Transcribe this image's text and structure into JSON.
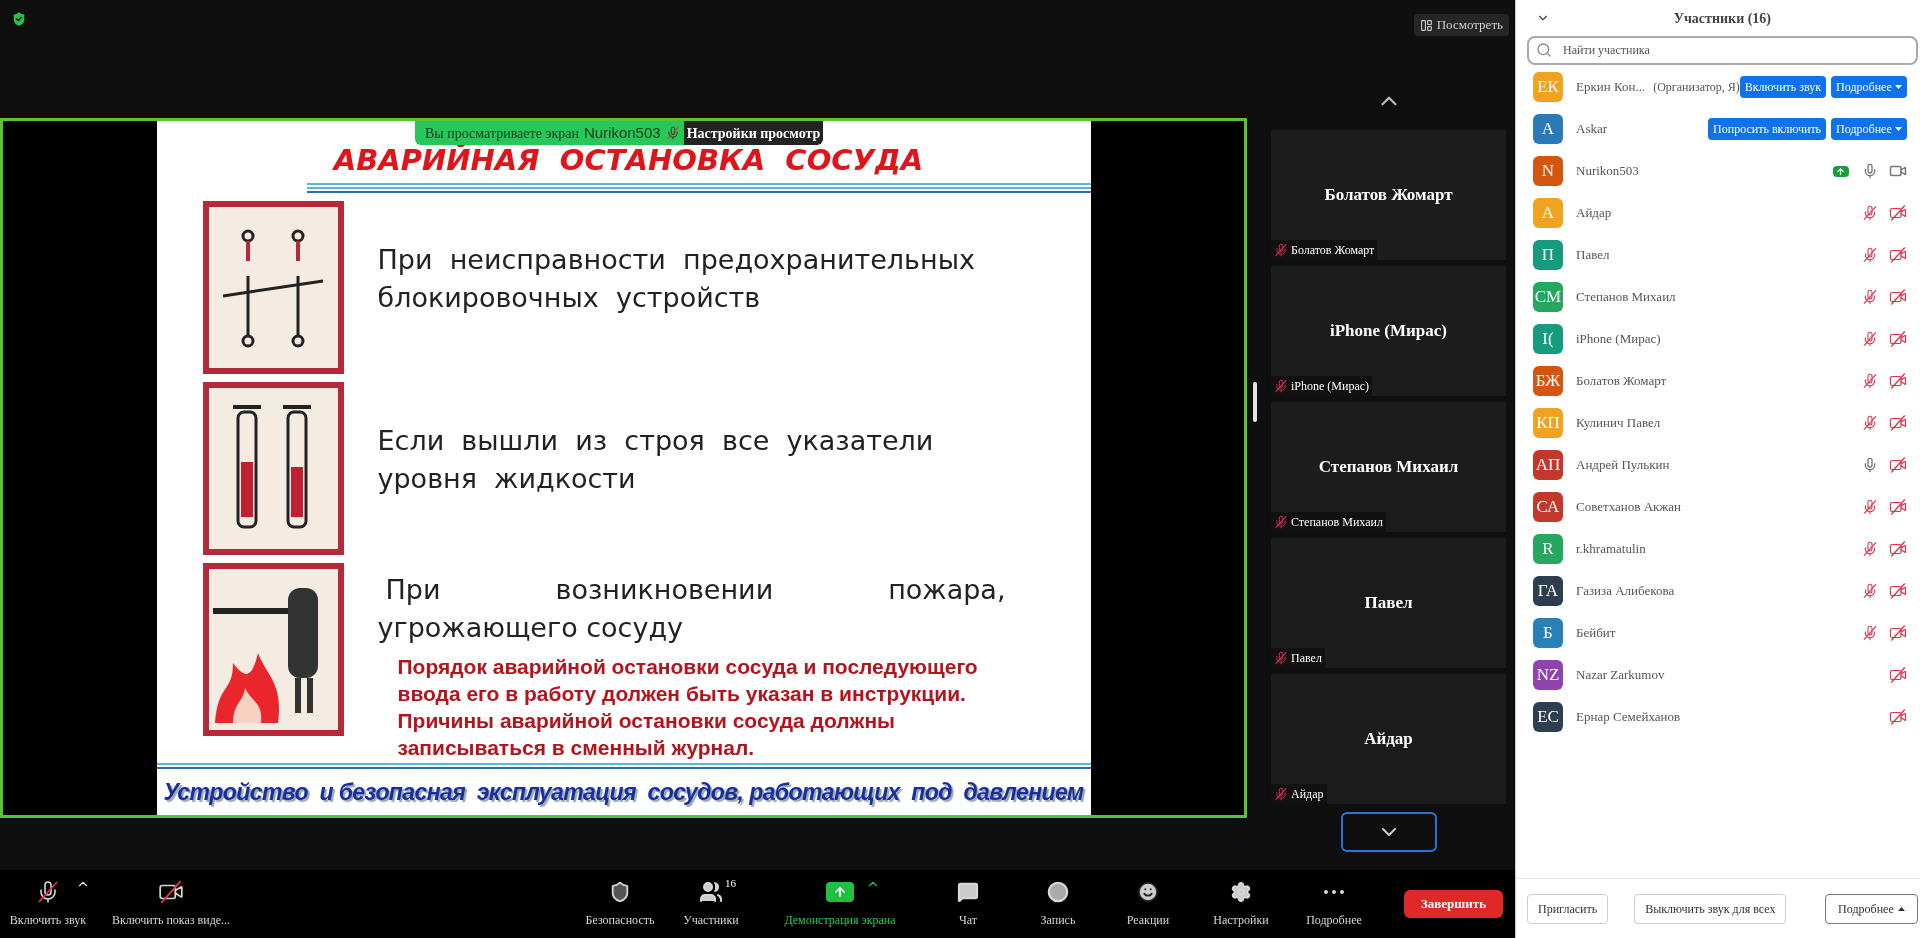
{
  "top_bar": {
    "view_button": "Посмотреть"
  },
  "share_banner": {
    "text": "Вы просматриваете экран",
    "presenter": "Nurikon503",
    "settings": "Настройки просмотр"
  },
  "slide": {
    "title": "АВАРИЙНАЯ  ОСТАНОВКА  СОСУДА",
    "items": [
      {
        "kind": "switch",
        "lines": [
          "При  неисправности  предохранительных",
          "блокировочных  устройств"
        ],
        "spread_first": false
      },
      {
        "kind": "gauge",
        "lines": [
          "Если  вышли  из  строя  все  указатели",
          "уровня  жидкости"
        ],
        "spread_first": false
      },
      {
        "kind": "fire",
        "lines": [
          "При возникновении пожара,",
          "угрожающего сосуду"
        ],
        "spread_first": true
      }
    ],
    "note": [
      "Порядок аварийной остановки сосуда и последующего",
      "ввода его в работу должен быть указан в инструкции.",
      "Причины аварийной остановки сосуда должны",
      "записываться в сменный журнал."
    ],
    "footer": "Устройство  и безопасная  эксплуатация  сосудов, работающих  под  давлением"
  },
  "video_tiles": [
    {
      "name": "Болатов Жомарт",
      "label": "Болатов Жомарт",
      "muted": true
    },
    {
      "name": "iPhone (Мирас)",
      "label": "iPhone (Мирас)",
      "muted": true
    },
    {
      "name": "Степанов Михаил",
      "label": "Степанов Михаил",
      "muted": true
    },
    {
      "name": "Павел",
      "label": "Павел",
      "muted": true
    },
    {
      "name": "Айдар",
      "label": "Айдар",
      "muted": true
    }
  ],
  "toolbar": {
    "items": [
      {
        "kind": "mic",
        "label": "Включить звук",
        "caret": true,
        "off": true
      },
      {
        "kind": "video",
        "label": "Включить показ виде...",
        "caret": false,
        "off": true
      },
      {
        "kind": "security",
        "label": "Безопасность",
        "caret": false
      },
      {
        "kind": "participants",
        "label": "Участники",
        "badge": "16",
        "caret": false
      },
      {
        "kind": "share",
        "label": "Демонстрация экрана",
        "caret": true
      },
      {
        "kind": "chat",
        "label": "Чат",
        "caret": false
      },
      {
        "kind": "record",
        "label": "Запись",
        "caret": false
      },
      {
        "kind": "reactions",
        "label": "Реакции",
        "caret": false
      },
      {
        "kind": "settings",
        "label": "Настройки",
        "caret": false
      },
      {
        "kind": "more",
        "label": "Подробнее",
        "caret": false
      }
    ],
    "end_button": "Завершить"
  },
  "participants": {
    "title": "Участники (16)",
    "search_placeholder": "Найти участника",
    "rows": [
      {
        "kind": "actions",
        "initials": "ЕК",
        "name": "Еркин Кон...",
        "role": "(Организатор, Я)",
        "color": "#f0a31f",
        "buttons": [
          "Включить звук",
          "Подробнее"
        ]
      },
      {
        "kind": "actions",
        "initials": "A",
        "name": "Askar",
        "color": "#2a79b8",
        "buttons": [
          "Попросить включить",
          "Подробнее"
        ]
      },
      {
        "kind": "status",
        "initials": "N",
        "name": "Nurikon503",
        "color": "#d3550f",
        "has_audio": true,
        "muted": false,
        "video_off": false,
        "sharing": true
      },
      {
        "kind": "status",
        "initials": "А",
        "name": "Айдар",
        "color": "#f0a31f",
        "has_audio": true,
        "muted": true,
        "video_off": true,
        "sharing": false
      },
      {
        "kind": "status",
        "initials": "П",
        "name": "Павел",
        "color": "#179b7f",
        "has_audio": true,
        "muted": true,
        "video_off": true,
        "sharing": false
      },
      {
        "kind": "status",
        "initials": "СМ",
        "name": "Степанов Михаил",
        "color": "#27a660",
        "has_audio": true,
        "muted": true,
        "video_off": true,
        "sharing": false
      },
      {
        "kind": "status",
        "initials": "I(",
        "name": "iPhone (Мирас)",
        "color": "#179b7f",
        "has_audio": true,
        "muted": true,
        "video_off": true,
        "sharing": false
      },
      {
        "kind": "status",
        "initials": "БЖ",
        "name": "Болатов Жомарт",
        "color": "#d3550f",
        "has_audio": true,
        "muted": true,
        "video_off": true,
        "sharing": false
      },
      {
        "kind": "status",
        "initials": "КП",
        "name": "Кулинич Павел",
        "color": "#f0a31f",
        "has_audio": true,
        "muted": true,
        "video_off": true,
        "sharing": false
      },
      {
        "kind": "status",
        "initials": "АП",
        "name": "Андрей Пулькин",
        "color": "#c0392b",
        "has_audio": true,
        "muted": false,
        "video_off": true,
        "sharing": false
      },
      {
        "kind": "status",
        "initials": "СА",
        "name": "Советханов Акжан",
        "color": "#c0392b",
        "has_audio": true,
        "muted": true,
        "video_off": true,
        "sharing": false
      },
      {
        "kind": "status",
        "initials": "R",
        "name": "r.khramatulin",
        "color": "#27a660",
        "has_audio": true,
        "muted": true,
        "video_off": true,
        "sharing": false
      },
      {
        "kind": "status",
        "initials": "ГА",
        "name": "Газиза Алибекова",
        "color": "#2c3e50",
        "has_audio": true,
        "muted": true,
        "video_off": true,
        "sharing": false
      },
      {
        "kind": "status",
        "initials": "Б",
        "name": "Бейбит",
        "color": "#2980b9",
        "has_audio": true,
        "muted": true,
        "video_off": true,
        "sharing": false
      },
      {
        "kind": "status",
        "initials": "NZ",
        "name": "Nazar Zarkumov",
        "color": "#8e44ad",
        "has_audio": false,
        "video_off": true,
        "sharing": false
      },
      {
        "kind": "status",
        "initials": "ЕС",
        "name": "Ернар Семейханов",
        "color": "#2c3e50",
        "has_audio": false,
        "video_off": true,
        "sharing": false
      }
    ],
    "footer_buttons": [
      {
        "label": "Пригласить",
        "caret": false
      },
      {
        "label": "Выключить звук для всех",
        "caret": false
      },
      {
        "label": "Подробнее",
        "caret": true
      }
    ]
  }
}
